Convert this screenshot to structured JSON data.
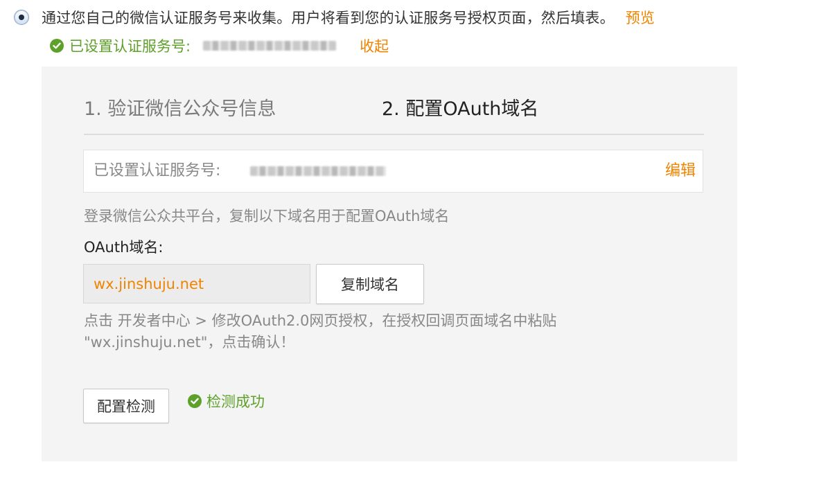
{
  "option": {
    "description": "通过您自己的微信认证服务号来收集。用户将看到您的认证服务号授权页面，然后填表。",
    "preview_label": "预览"
  },
  "status": {
    "set_account_label": "已设置认证服务号:",
    "collapse_label": "收起"
  },
  "steps": [
    {
      "label": "1. 验证微信公众号信息"
    },
    {
      "label": "2. 配置OAuth域名"
    }
  ],
  "account": {
    "label": "已设置认证服务号:",
    "edit_label": "编辑"
  },
  "hint": "登录微信公众共平台，复制以下域名用于配置OAuth域名",
  "domain": {
    "title": "OAuth域名:",
    "value": "wx.jinshuju.net",
    "copy_button": "复制域名"
  },
  "instructions": "点击 开发者中心 > 修改OAuth2.0网页授权，在授权回调页面域名中粘贴 \"wx.jinshuju.net\"，点击确认！",
  "detect": {
    "button_label": "配置检测",
    "result_label": "检测成功"
  },
  "colors": {
    "accent_orange": "#f08300",
    "success_green": "#5da12a",
    "panel_bg": "#f4f4f4"
  }
}
